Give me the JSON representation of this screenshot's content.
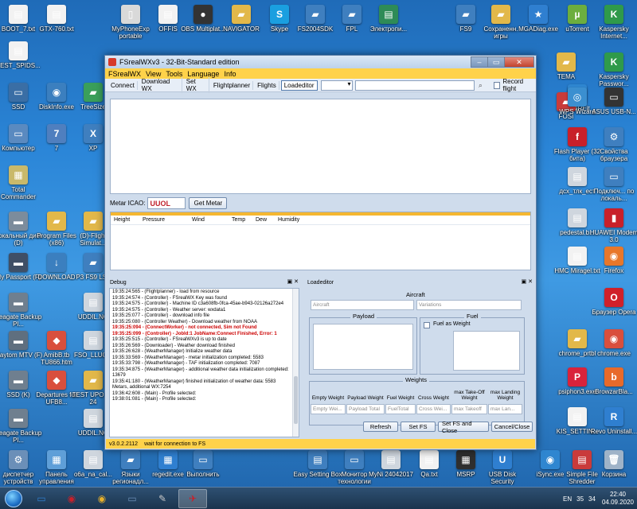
{
  "desktop": {
    "icons_left": [
      {
        "label": "BOOT_7.txt",
        "glyph": "▤",
        "color": "#f2f2f2"
      },
      {
        "label": "TEST_SPIDS...",
        "glyph": "▤",
        "color": "#f2f2f2"
      },
      {
        "label": "SSD",
        "glyph": "▭",
        "color": "#3a6ea5"
      },
      {
        "label": "Компьютер",
        "glyph": "▭",
        "color": "#5a8ac0"
      },
      {
        "label": "Total Commander",
        "glyph": "▦",
        "color": "#c9b96a"
      },
      {
        "label": "Локальный диск (D)",
        "glyph": "▬",
        "color": "#7c8c9c"
      },
      {
        "label": "My Passport (F)",
        "glyph": "▬",
        "color": "#3f4f66"
      },
      {
        "label": "Seagate Backup Pl...",
        "glyph": "▬",
        "color": "#6f7f8f"
      },
      {
        "label": "Playtom MTV (F)",
        "glyph": "▬",
        "color": "#5f6f7f"
      },
      {
        "label": "SSD (K)",
        "glyph": "▬",
        "color": "#6f7f8f"
      },
      {
        "label": "Seagate Backup Pl...",
        "glyph": "▬",
        "color": "#6f7f8f"
      },
      {
        "label": "диспетчер устройств",
        "glyph": "⚙",
        "color": "#6b8fb8"
      }
    ],
    "icons_col2": [
      {
        "label": "GTX-760.txt",
        "glyph": "▤",
        "color": "#f2f2f2"
      },
      {
        "label": "DiskInfo.exe",
        "glyph": "◉",
        "color": "#3b7fbf"
      },
      {
        "label": "7",
        "glyph": "7",
        "color": "#4f7fbf"
      },
      {
        "label": "Program Files (x86)",
        "glyph": "▰",
        "color": "#e2b84a"
      },
      {
        "label": "DOWNLOAD",
        "glyph": "↓",
        "color": "#3b7fbf"
      },
      {
        "label": "AmibB.tb TU866.htm",
        "glyph": "◆",
        "color": "#d94f3d"
      },
      {
        "label": "Departures for UFB8...",
        "glyph": "◆",
        "color": "#d94f3d"
      },
      {
        "label": "Панель управления",
        "glyph": "▦",
        "color": "#5f9fd8"
      }
    ],
    "icons_col3": [
      {
        "label": "TreeSize",
        "glyph": "▰",
        "color": "#3a9f5a"
      },
      {
        "label": "XP",
        "glyph": "X",
        "color": "#3f7fbf"
      },
      {
        "label": "(D)-Flight Simulat...",
        "glyph": "▰",
        "color": "#e2b84a"
      },
      {
        "label": "P3 FS9 LS2",
        "glyph": "▰",
        "color": "#3f7fbf"
      },
      {
        "label": "UDDIL.NO",
        "glyph": "▤",
        "color": "#cfd6de"
      },
      {
        "label": "FSO_LLUC...",
        "glyph": "▤",
        "color": "#cfd6de"
      },
      {
        "label": "TEST UPO AD 24",
        "glyph": "▰",
        "color": "#e2b84a"
      },
      {
        "label": "UDDIL.NO",
        "glyph": "▤",
        "color": "#cfd6de"
      },
      {
        "label": "o6a_na_cal...",
        "glyph": "▤",
        "color": "#cfd6de"
      }
    ],
    "icons_top": [
      {
        "label": "MyPhoneExp portable",
        "glyph": "▯",
        "color": "#d9d9d9"
      },
      {
        "label": "OFFIS",
        "glyph": "▤",
        "color": "#f2f2f2"
      },
      {
        "label": "OBS Multiplat...",
        "glyph": "●",
        "color": "#333333"
      },
      {
        "label": "NAVIGATOR",
        "glyph": "▰",
        "color": "#e2b84a"
      },
      {
        "label": "Skype",
        "glyph": "S",
        "color": "#1a9fe0"
      },
      {
        "label": "FS2004SDK",
        "glyph": "▰",
        "color": "#3f7fbf"
      },
      {
        "label": "FPL",
        "glyph": "▰",
        "color": "#3f7fbf"
      },
      {
        "label": "Электропи...",
        "glyph": "▤",
        "color": "#2e8b57"
      },
      {
        "label": "FS9",
        "glyph": "▰",
        "color": "#3f7fbf"
      },
      {
        "label": "Сохраненн. игры",
        "glyph": "▰",
        "color": "#e2b84a"
      },
      {
        "label": "MGADiag.exe",
        "glyph": "★",
        "color": "#2f7fd0"
      },
      {
        "label": "uTorrent",
        "glyph": "µ",
        "color": "#6cae3e"
      },
      {
        "label": "Kaspersky Internet...",
        "glyph": "K",
        "color": "#2f9a4a"
      }
    ],
    "icons_right": [
      {
        "label": "TEMA",
        "glyph": "▰",
        "color": "#e2b84a"
      },
      {
        "label": "SHAREit",
        "glyph": "◉",
        "color": "#2f86d0"
      },
      {
        "label": "Kaspersky Passwor...",
        "glyph": "K",
        "color": "#2f9a4a"
      },
      {
        "label": "FOSI",
        "glyph": "▰",
        "color": "#c93b3b"
      },
      {
        "label": "WPS Wizard",
        "glyph": "◎",
        "color": "#3b8fd0"
      },
      {
        "label": "ASUS USB-N...",
        "glyph": "▭",
        "color": "#333333"
      },
      {
        "label": "Flash Player (32 бита)",
        "glyph": "f",
        "color": "#c8202a"
      },
      {
        "label": "Свойства браузера",
        "glyph": "⚙",
        "color": "#3f7fbf"
      },
      {
        "label": "дсх_тлк_ест",
        "glyph": "▤",
        "color": "#cfd6de"
      },
      {
        "label": "Подключ... по локаль...",
        "glyph": "▭",
        "color": "#3f7fbf"
      },
      {
        "label": "pedestal.b...",
        "glyph": "▤",
        "color": "#cfd6de"
      },
      {
        "label": "HUAWEI Modem 3.0",
        "glyph": "▮",
        "color": "#c8202a"
      },
      {
        "label": "HMC Miragel.txt",
        "glyph": "▤",
        "color": "#f2f2f2"
      },
      {
        "label": "Firefox",
        "glyph": "◉",
        "color": "#e8772a"
      },
      {
        "label": "Браузер Opera",
        "glyph": "O",
        "color": "#d0202a"
      },
      {
        "label": "chrome_prtbl",
        "glyph": "▰",
        "color": "#e2b84a"
      },
      {
        "label": "chrome.exe",
        "glyph": "◉",
        "color": "#d94f3d"
      },
      {
        "label": "psiphon3.exe",
        "glyph": "P",
        "color": "#d9233b"
      },
      {
        "label": "BrowzarBla...",
        "glyph": "b",
        "color": "#e86a2a"
      },
      {
        "label": "KIS_SETTIN...",
        "glyph": "▤",
        "color": "#f2f2f2"
      },
      {
        "label": "Revo Uninstall...",
        "glyph": "R",
        "color": "#2f7fd0"
      },
      {
        "label": "iSync.exe",
        "glyph": "◉",
        "color": "#2f86d0"
      },
      {
        "label": "Simple File Shredder",
        "glyph": "▤",
        "color": "#c93b3b"
      },
      {
        "label": "Корзина",
        "glyph": "🗑",
        "color": "#9fb3c8"
      }
    ],
    "icons_bottom": [
      {
        "label": "Языки регионадл...",
        "glyph": "▰",
        "color": "#3f7fbf"
      },
      {
        "label": "regedit.exe",
        "glyph": "▦",
        "color": "#2f7fd0"
      },
      {
        "label": "Выполнить",
        "glyph": "▭",
        "color": "#3f7fbf"
      },
      {
        "label": "Easy Setting Box",
        "glyph": "▤",
        "color": "#3f7fbf"
      },
      {
        "label": "Монитор технологии",
        "glyph": "▭",
        "color": "#3f7fbf"
      },
      {
        "label": "MyNi 24042017",
        "glyph": "▤",
        "color": "#cfd6de"
      },
      {
        "label": "Qa.txt",
        "glyph": "▤",
        "color": "#f2f2f2"
      },
      {
        "label": "MSRP",
        "glyph": "▦",
        "color": "#2f2f2f"
      },
      {
        "label": "USB Disk Security",
        "glyph": "U",
        "color": "#2f7fd0"
      }
    ],
    "partial_labels": [
      "ИДЕР...",
      "...eCal_SD...",
      "...12",
      "...10_...da.pdf",
      "...AKLD",
      "...ev_Tu...",
      "...s"
    ]
  },
  "window": {
    "title": "FSrealWXv3 - 32-Bit-Standard edition",
    "controls": {
      "minimize": "–",
      "maximize": "▭",
      "close": "✕"
    },
    "menu": [
      "FSrealWX",
      "View",
      "Tools",
      "Language",
      "Info"
    ],
    "toolbar": {
      "items": [
        "Connect",
        "Download WX",
        "Set WX",
        "Flightplanner",
        "Flights",
        "Loadeditor"
      ],
      "active": "Loadeditor",
      "search_value": "",
      "record_flight_label": "Record flight"
    },
    "metar": {
      "label": "Metar ICAO:",
      "value": "UUOL",
      "button": "Get Metar"
    },
    "weather_table": {
      "columns": [
        "Height",
        "Pressure",
        "Wind",
        "Temp",
        "Dew",
        "Humidity"
      ]
    },
    "debug": {
      "title": "Debug",
      "pin_icons": "▣ ✕",
      "log": [
        {
          "t": "19:35:24:565 - (Flightplanner) - load from resource",
          "err": false
        },
        {
          "t": "19:35:24:574 - (Controller) - FSrealWX Key was found",
          "err": false
        },
        {
          "t": "19:35:24:575 - (Controller) - Machine ID c3a608fb-0fca-45ae-b943-02126a272e4",
          "err": false
        },
        {
          "t": "19:35:24:575 - (Controller) - Weather server: wxdata1",
          "err": false
        },
        {
          "t": "19:35:25:077 - (Controller) - download info file",
          "err": false
        },
        {
          "t": "19:35:25:080 - (Controller Weather) - Download weather from NOAA",
          "err": false
        },
        {
          "t": "19:35:25:094 - (ConnectWorker) - not connected, Sim not Found",
          "err": true
        },
        {
          "t": "19:35:25:099 - (Controller) - JobId:1 JobName:Connect Finished, Error: 1",
          "err": true
        },
        {
          "t": "19:35:25:515 - (Controller) - FSrealWXv3 is up to date",
          "err": false
        },
        {
          "t": "19:35:26:569 - (Downloader) - Weather download finished",
          "err": false
        },
        {
          "t": "19:35:26:628 - (WeatherManager) Initialize weather data",
          "err": false
        },
        {
          "t": "19:35:33:569 - (WeatherManager) - metar initialization completed: 5583",
          "err": false
        },
        {
          "t": "19:35:33:798 - (WeatherManager) - TAF initialization completed: 7087",
          "err": false
        },
        {
          "t": "19:35:34:875 - (WeatherManager) - additional weather data initialization completed: 13679",
          "err": false
        },
        {
          "t": "19:35:41:180 - (WeatherManager) finished initialization of weather data: 5583 Metars, additional WX:7254",
          "err": false
        },
        {
          "t": "19:36:42:608 - (Main) - Profile selected:",
          "err": false
        },
        {
          "t": "19:38:01:081 - (Main) - Profile selected:",
          "err": false
        }
      ]
    },
    "loadeditor": {
      "title": "Loadeditor",
      "pin_icons": "▣ ✕",
      "aircraft": {
        "title": "Aircraft",
        "aircraft_placeholder": "Aircraft",
        "variations_placeholder": "Variations"
      },
      "payload": {
        "title": "Payload"
      },
      "fuel": {
        "title": "Fuel",
        "fuel_as_weight": "Fuel as Weight"
      },
      "weights": {
        "title": "Weights",
        "labels": [
          "Empty Weight",
          "Payload Weight",
          "Fuel Weight",
          "Cross Weight",
          "max Take-Off Weight",
          "max Landing Weight"
        ],
        "values": [
          "Empty Wei...",
          "Payload Total",
          "FuelTotal",
          "Cross Wei...",
          "max Takeoff",
          "max Lan..."
        ]
      },
      "buttons": [
        "Refresh",
        "Set FS",
        "Set FS and Close",
        "Cancel/Close"
      ]
    },
    "status": {
      "version": "v3.0.2.2112",
      "message": "wait for connection to FS"
    }
  },
  "taskbar": {
    "apps": [
      {
        "glyph": "▭",
        "color": "#2f7fd0"
      },
      {
        "glyph": "◉",
        "color": "#c8202a"
      },
      {
        "glyph": "◉",
        "color": "#e8b02a"
      },
      {
        "glyph": "▭",
        "color": "#6b8fb8"
      },
      {
        "glyph": "✎",
        "color": "#c9c9c9"
      },
      {
        "glyph": "✈",
        "color": "#c8202a"
      }
    ],
    "tray": {
      "lang": "EN",
      "count": "35",
      "num": "34",
      "time": "22:40",
      "date": "04.09.2020"
    }
  }
}
